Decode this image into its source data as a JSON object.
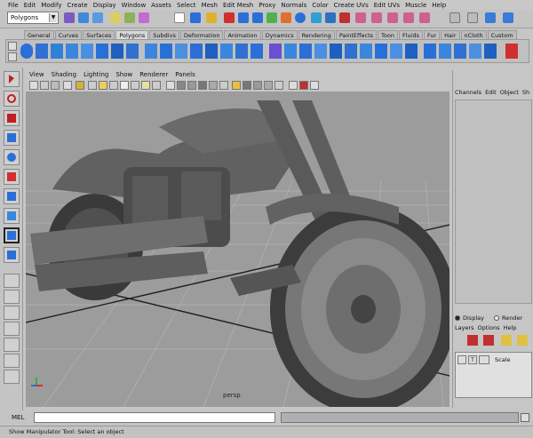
{
  "menu": [
    "File",
    "Edit",
    "Modify",
    "Create",
    "Display",
    "Window",
    "Assets",
    "Select",
    "Mesh",
    "Edit Mesh",
    "Proxy",
    "Normals",
    "Color",
    "Create UVs",
    "Edit UVs",
    "Muscle",
    "Help"
  ],
  "mode_select": {
    "value": "Polygons"
  },
  "shelf_tabs": [
    "General",
    "Curves",
    "Surfaces",
    "Polygons",
    "Subdivs",
    "Deformation",
    "Animation",
    "Dynamics",
    "Rendering",
    "PaintEffects",
    "Toon",
    "Fluids",
    "Fur",
    "Hair",
    "nCloth",
    "Custom"
  ],
  "shelf_active": "Polygons",
  "panel_menu": [
    "View",
    "Shading",
    "Lighting",
    "Show",
    "Renderer",
    "Panels"
  ],
  "viewport": {
    "camera_label": "persp"
  },
  "channel_box": {
    "menu": [
      "Channels",
      "Edit",
      "Object",
      "Sh"
    ]
  },
  "layer_editor": {
    "display_label": "Display",
    "render_label": "Render",
    "menu": [
      "Layers",
      "Options",
      "Help"
    ],
    "row_t": "T",
    "row_scale": "Scale"
  },
  "command_line": {
    "label": "MEL"
  },
  "help_line": {
    "text": "Show Manipulator Tool: Select an object"
  },
  "colors": {
    "ui_bg": "#c6c6c6",
    "viewport_bg": "#9c9c9c",
    "grid": "#b4b4b4",
    "grid_axis": "#202020",
    "model": "#5a5a5a",
    "icon_blue": "#2a6fd6",
    "icon_red": "#d03030"
  }
}
